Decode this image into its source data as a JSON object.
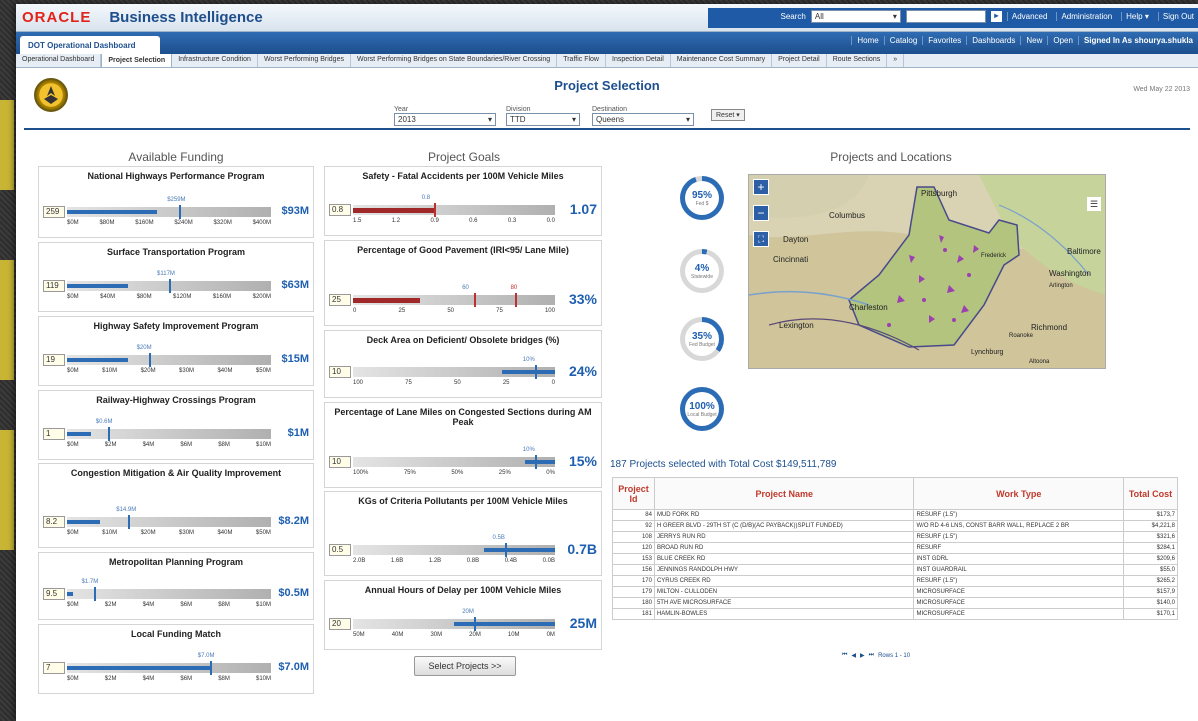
{
  "brand": {
    "oracle": "ORACLE",
    "app": "Business Intelligence"
  },
  "topbar": {
    "search_label": "Search",
    "search_scope": "All",
    "advanced": "Advanced",
    "administration": "Administration",
    "help": "Help",
    "sign_out": "Sign Out"
  },
  "nav": {
    "dashboard_tab": "DOT Operational Dashboard",
    "links": [
      "Home",
      "Catalog",
      "Favorites",
      "Dashboards",
      "New",
      "Open",
      "Signed In As  shourya.shukla"
    ]
  },
  "tabs": [
    "Operational Dashboard",
    "Project Selection",
    "Infrastructure Condition",
    "Worst Performing Bridges",
    "Worst Performing Bridges on State Boundaries/River Crossing",
    "Traffic Flow",
    "Inspection Detail",
    "Maintenance Cost Summary",
    "Project Detail",
    "Route Sections",
    "»"
  ],
  "page": {
    "title": "Project Selection",
    "date": "Wed May 22 2013"
  },
  "prompts": [
    {
      "label": "Year",
      "value": "2013"
    },
    {
      "label": "Division",
      "value": "TTD"
    },
    {
      "label": "Destination",
      "value": "Queens"
    }
  ],
  "reset": "Reset",
  "funding": {
    "title": "Available Funding",
    "items": [
      {
        "name": "National Highways Performance Program",
        "value": "259",
        "big": "$93M",
        "target": "$259M",
        "fill": 0.44,
        "tick": 0.55,
        "axis": [
          "$0M",
          "$80M",
          "$160M",
          "$240M",
          "$320M",
          "$400M"
        ]
      },
      {
        "name": "Surface Transportation Program",
        "value": "119",
        "big": "$63M",
        "target": "$117M",
        "fill": 0.3,
        "tick": 0.5,
        "axis": [
          "$0M",
          "$40M",
          "$80M",
          "$120M",
          "$160M",
          "$200M"
        ]
      },
      {
        "name": "Highway Safety Improvement Program",
        "value": "19",
        "big": "$15M",
        "target": "$20M",
        "fill": 0.3,
        "tick": 0.4,
        "axis": [
          "$0M",
          "$10M",
          "$20M",
          "$30M",
          "$40M",
          "$50M"
        ]
      },
      {
        "name": "Railway-Highway Crossings Program",
        "value": "1",
        "big": "$1M",
        "target": "$0.6M",
        "fill": 0.12,
        "tick": 0.2,
        "axis": [
          "$0M",
          "$2M",
          "$4M",
          "$6M",
          "$8M",
          "$10M"
        ]
      },
      {
        "name": "Congestion Mitigation & Air Quality Improvement",
        "value": "8.2",
        "big": "$8.2M",
        "target": "$14.9M",
        "fill": 0.16,
        "tick": 0.3,
        "axis": [
          "$0M",
          "$10M",
          "$20M",
          "$30M",
          "$40M",
          "$50M"
        ]
      },
      {
        "name": "Metropolitan Planning Program",
        "value": "9.5",
        "big": "$0.5M",
        "target": "$1.7M",
        "fill": 0.03,
        "tick": 0.13,
        "axis": [
          "$0M",
          "$2M",
          "$4M",
          "$6M",
          "$8M",
          "$10M"
        ]
      },
      {
        "name": "Local Funding Match",
        "value": "7",
        "big": "$7.0M",
        "target": "$7.0M",
        "fill": 0.7,
        "tick": 0.7,
        "axis": [
          "$0M",
          "$2M",
          "$4M",
          "$6M",
          "$8M",
          "$10M"
        ]
      }
    ]
  },
  "goals": {
    "title": "Project Goals",
    "items": [
      {
        "name": "Safety - Fatal Accidents per 100M Vehicle Miles",
        "value": "0.8",
        "big": "1.07",
        "target": "0.8",
        "fill": 0.4,
        "tick": 0.4,
        "red": true,
        "axis": [
          "1.5",
          "1.2",
          "0.9",
          "0.6",
          "0.3",
          "0.0"
        ]
      },
      {
        "name": "Percentage of Good Pavement (IRI<95/ Lane Mile)",
        "value": "25",
        "big": "33%",
        "target": "60",
        "target2": "80",
        "fill": 0.33,
        "tick": 0.6,
        "tick2": 0.8,
        "red": true,
        "axis": [
          "0",
          "25",
          "50",
          "75",
          "100"
        ]
      },
      {
        "name": "Deck Area on Deficient/ Obsolete bridges (%)",
        "value": "10",
        "big": "24%",
        "target": "10%",
        "fill": 0.26,
        "tick": 0.9,
        "axis": [
          "100",
          "75",
          "50",
          "25",
          "0"
        ],
        "rightfill": true
      },
      {
        "name": "Percentage of Lane Miles on Congested Sections during AM Peak",
        "value": "10",
        "big": "15%",
        "target": "10%",
        "fill": 0.15,
        "tick": 0.9,
        "axis": [
          "100%",
          "75%",
          "50%",
          "25%",
          "0%"
        ],
        "rightfill": true
      },
      {
        "name": "KGs of Criteria Pollutants per 100M Vehicle Miles",
        "value": "0.5",
        "big": "0.7B",
        "target": "0.5B",
        "fill": 0.35,
        "tick": 0.75,
        "axis": [
          "2.0B",
          "1.6B",
          "1.2B",
          "0.8B",
          "0.4B",
          "0.0B"
        ],
        "rightfill": true
      },
      {
        "name": "Annual Hours of Delay per 100M Vehicle Miles",
        "value": "20",
        "big": "25M",
        "target": "20M",
        "fill": 0.5,
        "tick": 0.6,
        "axis": [
          "50M",
          "40M",
          "30M",
          "20M",
          "10M",
          "0M"
        ],
        "rightfill": true
      }
    ]
  },
  "locations": {
    "title": "Projects and Locations",
    "circles": [
      {
        "pct": "95%",
        "label": "Fed $",
        "level": 0.95
      },
      {
        "pct": "4%",
        "label": "Statewide",
        "level": 0.04
      },
      {
        "pct": "35%",
        "label": "Fed Budget",
        "level": 0.35
      },
      {
        "pct": "100%",
        "label": "Local Budget",
        "level": 1.0
      }
    ],
    "map_labels": [
      "Pittsburgh",
      "Columbus",
      "Dayton",
      "Cincinnati",
      "Lexington",
      "Charleston",
      "Baltimore",
      "Washington",
      "Arlington",
      "Richmond",
      "Lynchburg",
      "Roanoke",
      "Altoona",
      "Frederick"
    ]
  },
  "summary": "187 Projects selected with Total Cost $149,511,789",
  "table": {
    "headers": [
      "Project Id",
      "Project Name",
      "Work Type",
      "Total Cost"
    ],
    "rows": [
      [
        "84",
        "MUD FORK RD",
        "RESURF (1.5\")",
        "$173,7"
      ],
      [
        "92",
        "H GREER BLVD - 29TH ST (C (D/B)(AC PAYBACK))SPLIT FUNDED)",
        "W/O RD 4-6 LNS, CONST BARR WALL, REPLACE 2 BR",
        "$4,221,8"
      ],
      [
        "108",
        "JERRYS RUN RD",
        "RESURF (1.5\")",
        "$321,6"
      ],
      [
        "120",
        "BROAD RUN RD",
        "RESURF",
        "$284,1"
      ],
      [
        "153",
        "BLUE CREEK RD",
        "INST GDRL",
        "$209,6"
      ],
      [
        "156",
        "JENNINGS RANDOLPH HWY",
        "INST GUARDRAIL",
        "$55,0"
      ],
      [
        "170",
        "CYRUS CREEK RD",
        "RESURF (1.5\")",
        "$265,2"
      ],
      [
        "179",
        "MILTON - CULLODEN",
        "MICROSURFACE",
        "$157,9"
      ],
      [
        "180",
        "5TH AVE MICROSURFACE",
        "MICROSURFACE",
        "$140,0"
      ],
      [
        "181",
        "HAMLIN-BOWLES",
        "MICROSURFACE",
        "$170,1"
      ]
    ]
  },
  "pager": "Rows 1 - 10",
  "select_button": "Select Projects >>",
  "colors": {
    "brand_red": "#e2231a",
    "nav_blue": "#1d4f8d",
    "gauge_blue": "#2b6cb5",
    "gauge_red": "#a02828",
    "header_red": "#c0392b"
  }
}
